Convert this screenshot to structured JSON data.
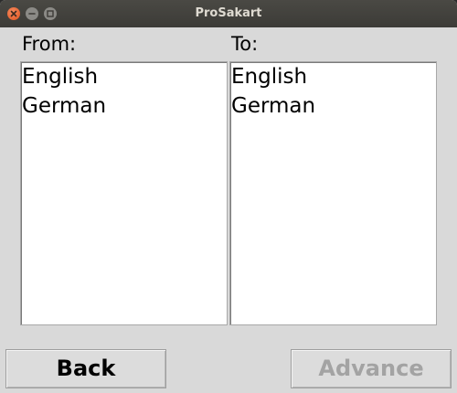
{
  "window": {
    "title": "ProSakart"
  },
  "from_panel": {
    "label": "From:",
    "items": [
      "English",
      "German"
    ]
  },
  "to_panel": {
    "label": "To:",
    "items": [
      "English",
      "German"
    ]
  },
  "buttons": {
    "back_label": "Back",
    "advance_label": "Advance",
    "advance_enabled": false
  },
  "colors": {
    "close_button": "#e0531f",
    "window_bg": "#d9d9d9",
    "titlebar_bg": "#3c3b37",
    "disabled_text": "#a3a3a3"
  }
}
